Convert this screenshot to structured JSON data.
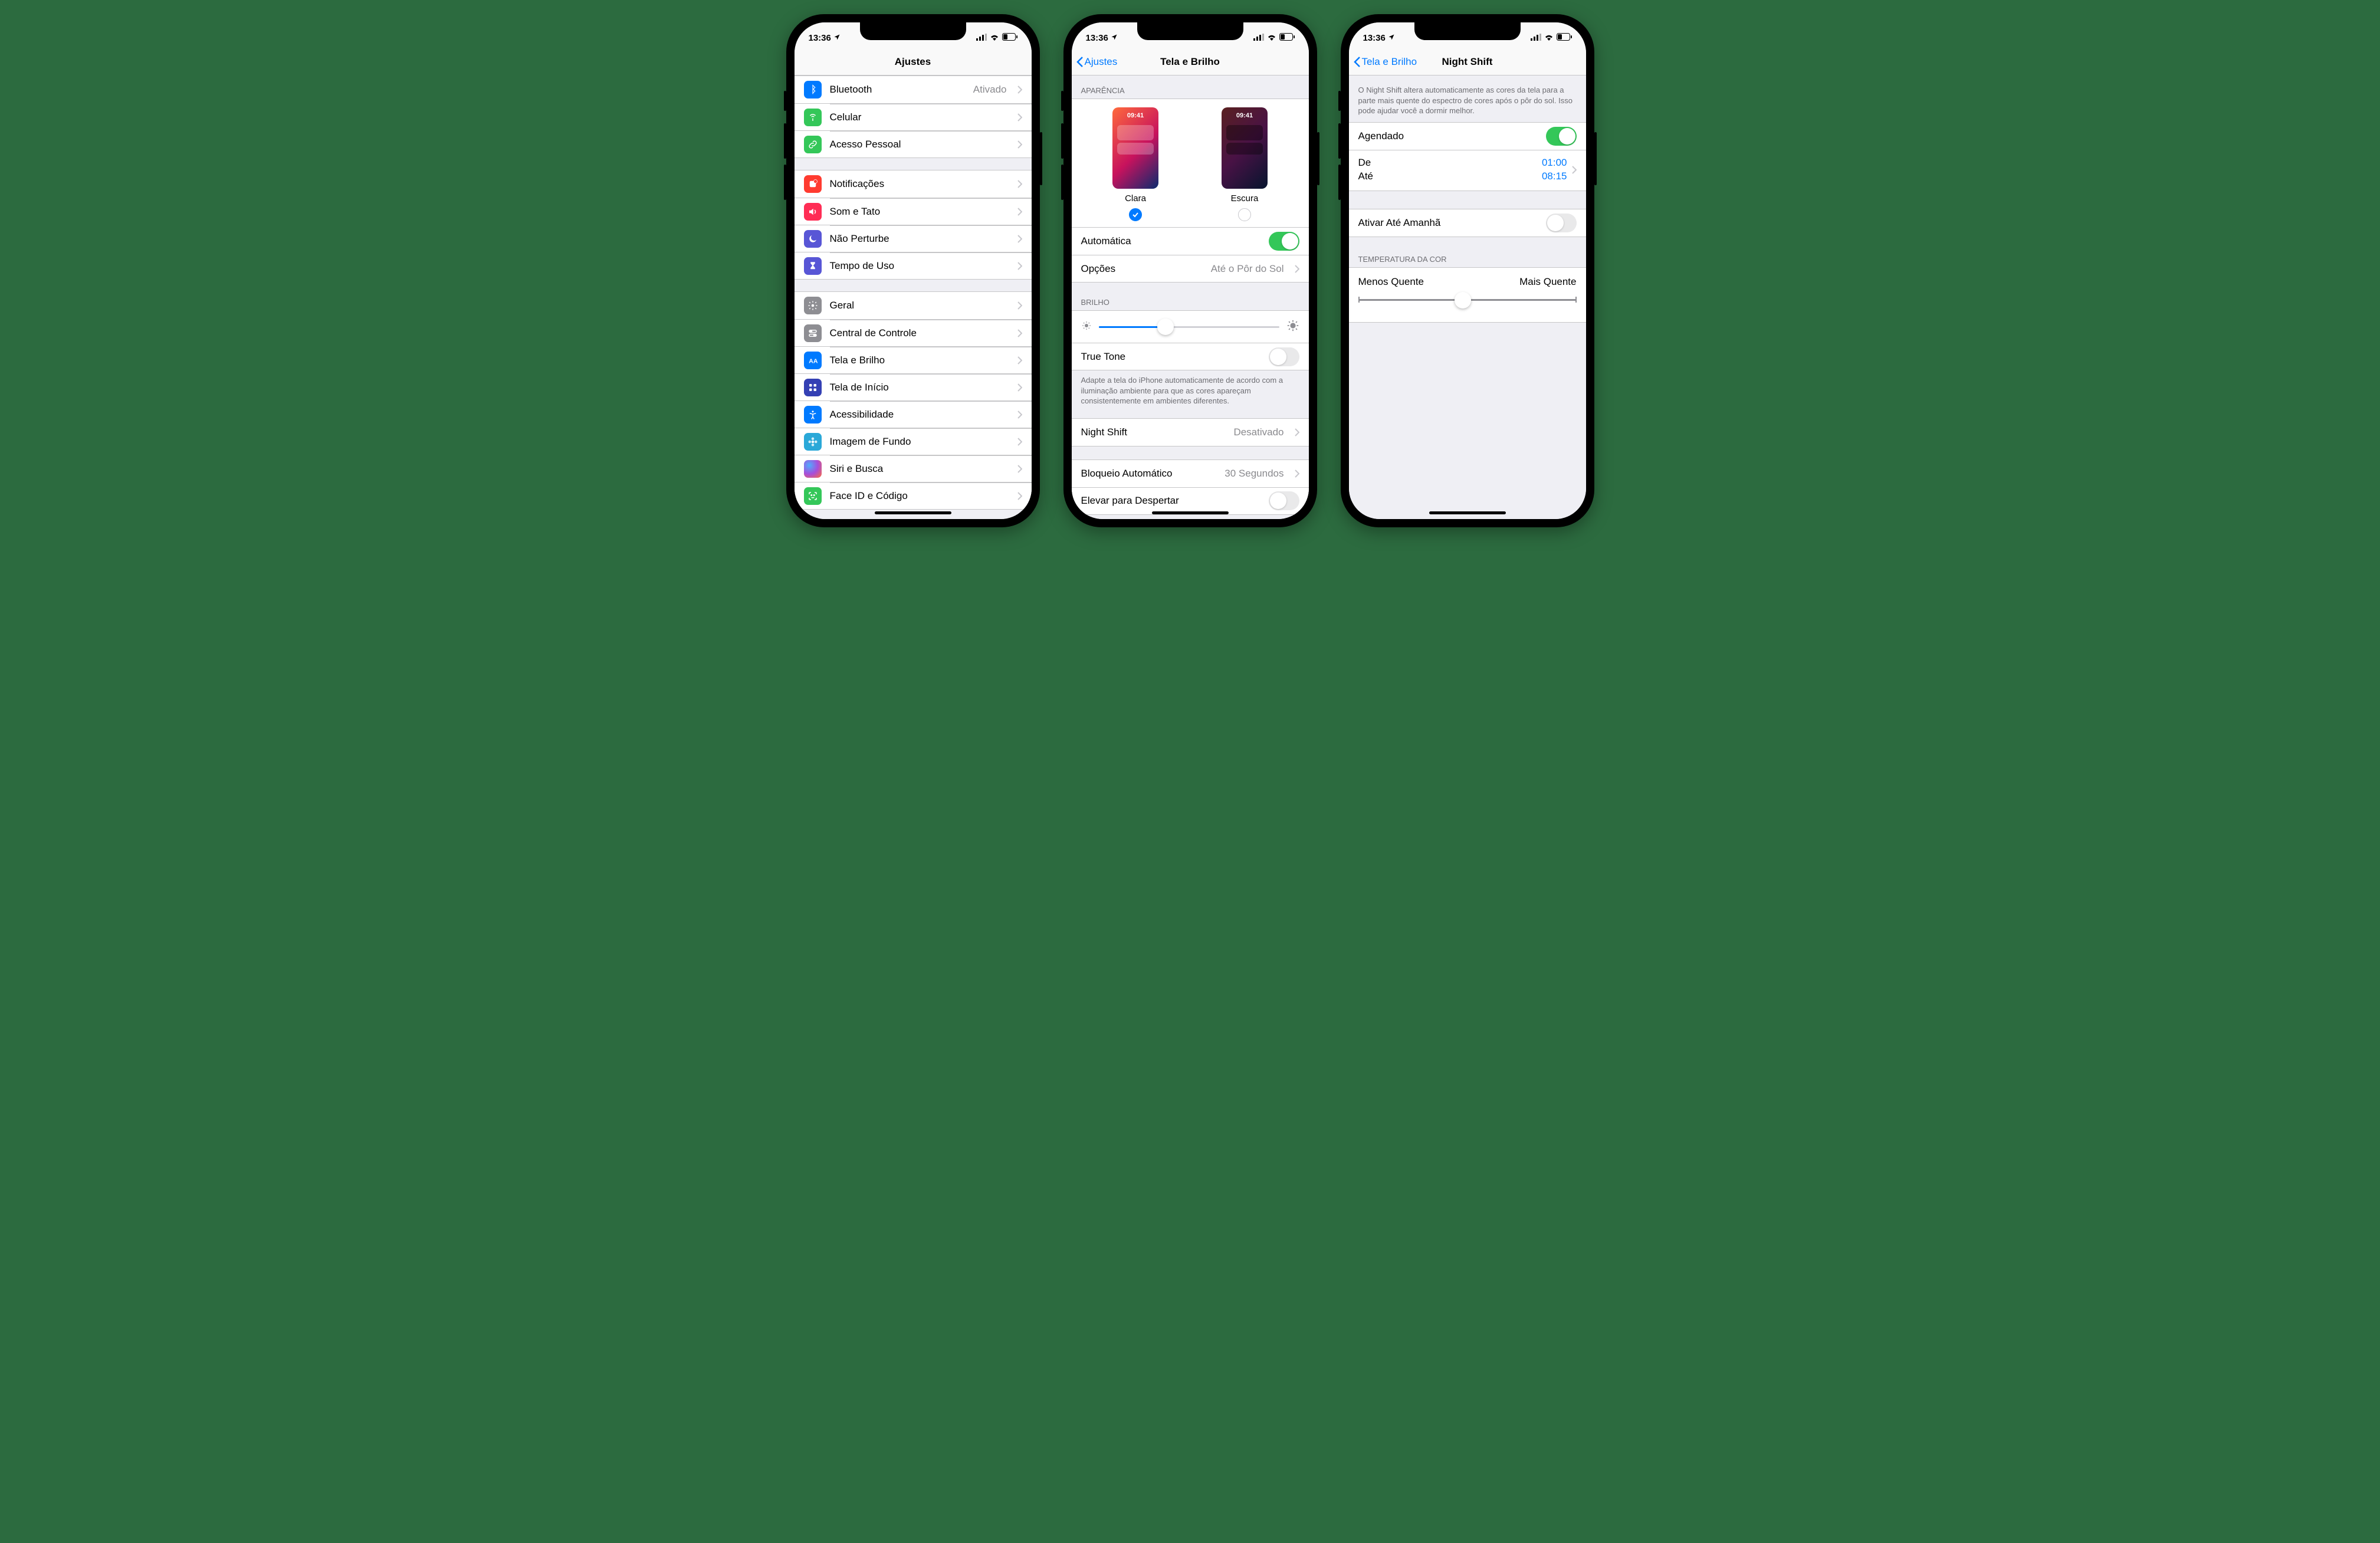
{
  "status": {
    "time": "13:36"
  },
  "phone1": {
    "title": "Ajustes",
    "group1": [
      {
        "label": "Bluetooth",
        "detail": "Ativado",
        "icon": "bluetooth-icon",
        "color": "c-blue1"
      },
      {
        "label": "Celular",
        "icon": "antenna-icon",
        "color": "c-green"
      },
      {
        "label": "Acesso Pessoal",
        "icon": "link-icon",
        "color": "c-green"
      }
    ],
    "group2": [
      {
        "label": "Notificações",
        "icon": "notifications-icon",
        "color": "c-red"
      },
      {
        "label": "Som e Tato",
        "icon": "speaker-icon",
        "color": "c-red2"
      },
      {
        "label": "Não Perturbe",
        "icon": "moon-icon",
        "color": "c-purple"
      },
      {
        "label": "Tempo de Uso",
        "icon": "hourglass-icon",
        "color": "c-purple"
      }
    ],
    "group3": [
      {
        "label": "Geral",
        "icon": "gear-icon",
        "color": "c-gray"
      },
      {
        "label": "Central de Controle",
        "icon": "switches-icon",
        "color": "c-gray"
      },
      {
        "label": "Tela e Brilho",
        "icon": "text-size-icon",
        "color": "c-blue1"
      },
      {
        "label": "Tela de Início",
        "icon": "grid-icon",
        "color": "c-darkblue"
      },
      {
        "label": "Acessibilidade",
        "icon": "accessibility-icon",
        "color": "c-blue1"
      },
      {
        "label": "Imagem de Fundo",
        "icon": "flower-icon",
        "color": "c-darkblue"
      },
      {
        "label": "Siri e Busca",
        "icon": "siri-icon",
        "color": "c-black"
      },
      {
        "label": "Face ID e Código",
        "icon": "faceid-icon",
        "color": "c-green"
      }
    ]
  },
  "phone2": {
    "back": "Ajustes",
    "title": "Tela e Brilho",
    "appearance_header": "Aparência",
    "light": {
      "label": "Clara",
      "time": "09:41",
      "checked": true
    },
    "dark": {
      "label": "Escura",
      "time": "09:41",
      "checked": false
    },
    "automatic": {
      "label": "Automática",
      "on": true
    },
    "options": {
      "label": "Opções",
      "detail": "Até o Pôr do Sol"
    },
    "brightness_header": "Brilho",
    "brightness_pct": 37,
    "truetone": {
      "label": "True Tone",
      "on": false
    },
    "truetone_footer": "Adapte a tela do iPhone automaticamente de acordo com a iluminação ambiente para que as cores apareçam consistentemente em ambientes diferentes.",
    "nightshift": {
      "label": "Night Shift",
      "detail": "Desativado"
    },
    "autolock": {
      "label": "Bloqueio Automático",
      "detail": "30 Segundos"
    },
    "raise": {
      "label": "Elevar para Despertar"
    }
  },
  "phone3": {
    "back": "Tela e Brilho",
    "title": "Night Shift",
    "intro": "O Night Shift altera automaticamente as cores da tela para a parte mais quente do espectro de cores após o pôr do sol. Isso pode ajudar você a dormir melhor.",
    "scheduled": {
      "label": "Agendado",
      "on": true
    },
    "from_label": "De",
    "to_label": "Até",
    "from_time": "01:00",
    "to_time": "08:15",
    "manual": {
      "label": "Ativar Até Amanhã",
      "on": false
    },
    "temp_header": "Temperatura da Cor",
    "temp_less": "Menos Quente",
    "temp_more": "Mais Quente",
    "temp_pct": 48
  }
}
